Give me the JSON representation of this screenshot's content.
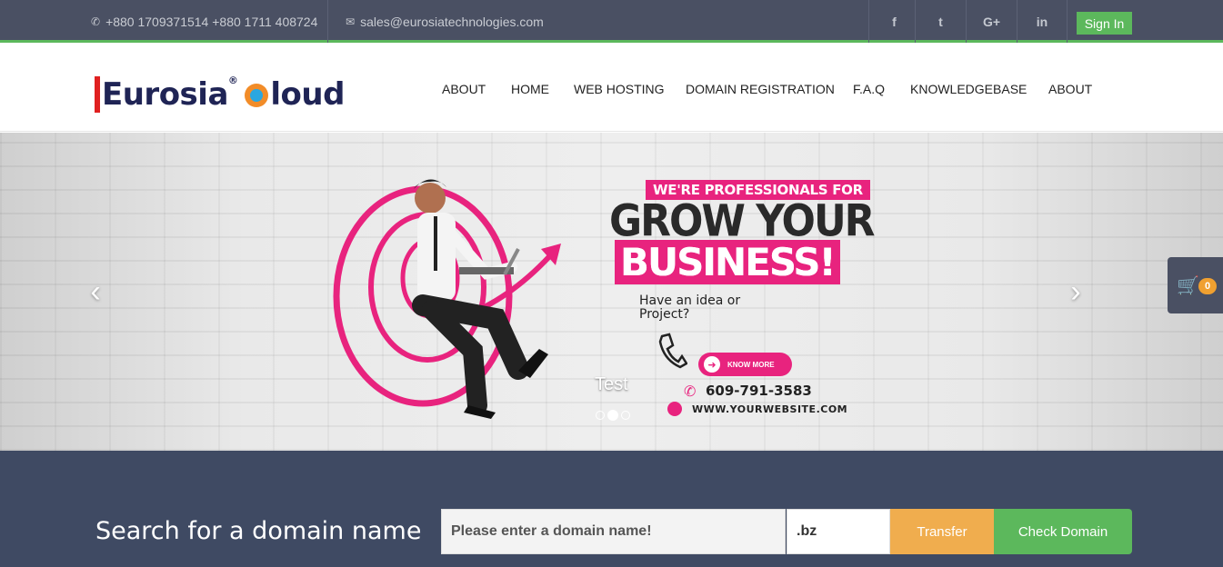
{
  "topbar": {
    "phone": "+880 1709371514 +880 1711 408724",
    "email": "sales@eurosiatechnologies.com",
    "social": [
      {
        "name": "facebook",
        "glyph": "f"
      },
      {
        "name": "twitter",
        "glyph": "t"
      },
      {
        "name": "google-plus",
        "glyph": "G+"
      },
      {
        "name": "linkedin",
        "glyph": "in"
      }
    ],
    "signin_label": "Sign In"
  },
  "header": {
    "logo_text_1": "Eurosia",
    "logo_reg": "®",
    "logo_text_2": "loud",
    "nav": [
      "ABOUT",
      "HOME",
      "WEB HOSTING",
      "DOMAIN REGISTRATION",
      "F.A.Q",
      "KNOWLEDGEBASE",
      "ABOUT"
    ]
  },
  "slider": {
    "tagline": "WE'RE PROFESSIONALS FOR",
    "headline_1": "GROW YOUR",
    "headline_2": "BUSINESS!",
    "idea_text": "Have an idea or Project?",
    "cta_label": "KNOW MORE",
    "phone": "609-791-3583",
    "website": "WWW.YOURWEBSITE.COM",
    "caption": "Test",
    "active_slide": 2,
    "slide_count": 3
  },
  "cart": {
    "count": "0"
  },
  "domain_search": {
    "heading": "Search for a domain name",
    "placeholder": "Please enter a domain name!",
    "tld": ".bz",
    "transfer_label": "Transfer",
    "check_label": "Check Domain"
  },
  "colors": {
    "topbar": "#4a5063",
    "accent_green": "#5cb85c",
    "pink": "#e8237e",
    "orange": "#f0ad4e",
    "domain_bg": "#3f4a63"
  }
}
